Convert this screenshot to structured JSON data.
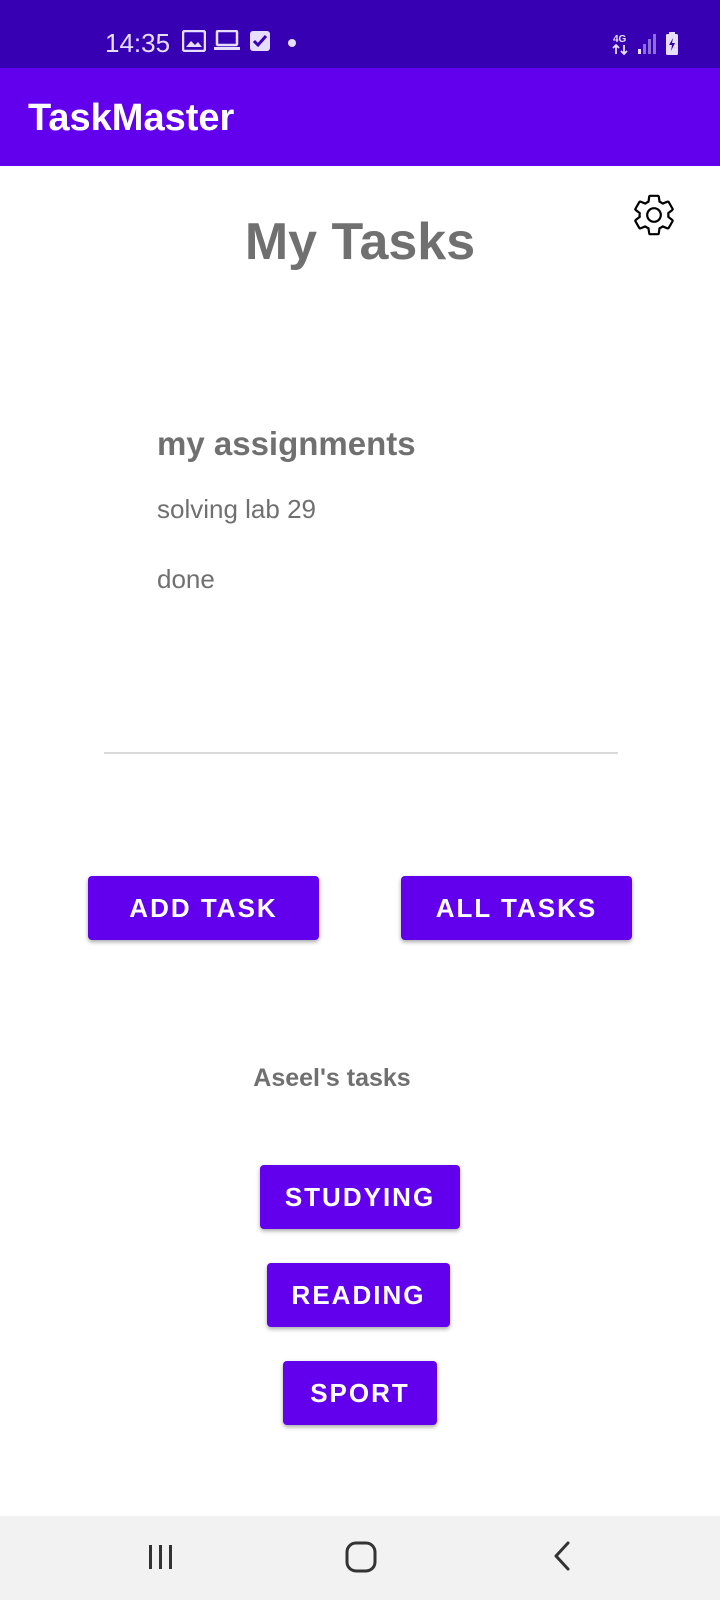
{
  "status_bar": {
    "time": "14:35",
    "icons": [
      "image-icon",
      "laptop-icon",
      "checkbox-icon",
      "dot-icon",
      "4g-icon",
      "signal-icon",
      "battery-icon"
    ]
  },
  "app_bar": {
    "title": "TaskMaster"
  },
  "header": {
    "title": "My Tasks",
    "settings_icon": "gear-icon"
  },
  "task_card": {
    "title": "my assignments",
    "body": "solving lab 29",
    "state": "done"
  },
  "actions": {
    "add_task": "ADD TASK",
    "all_tasks": "ALL TASKS"
  },
  "user_section": {
    "label": "Aseel's tasks",
    "buttons": [
      "STUDYING",
      "READING",
      "SPORT"
    ]
  },
  "nav_bar": {
    "icons": [
      "recent-apps-icon",
      "home-icon",
      "back-icon"
    ]
  },
  "colors": {
    "status_bar": "#3700b3",
    "primary": "#6200ee",
    "text_gray": "#707070"
  }
}
